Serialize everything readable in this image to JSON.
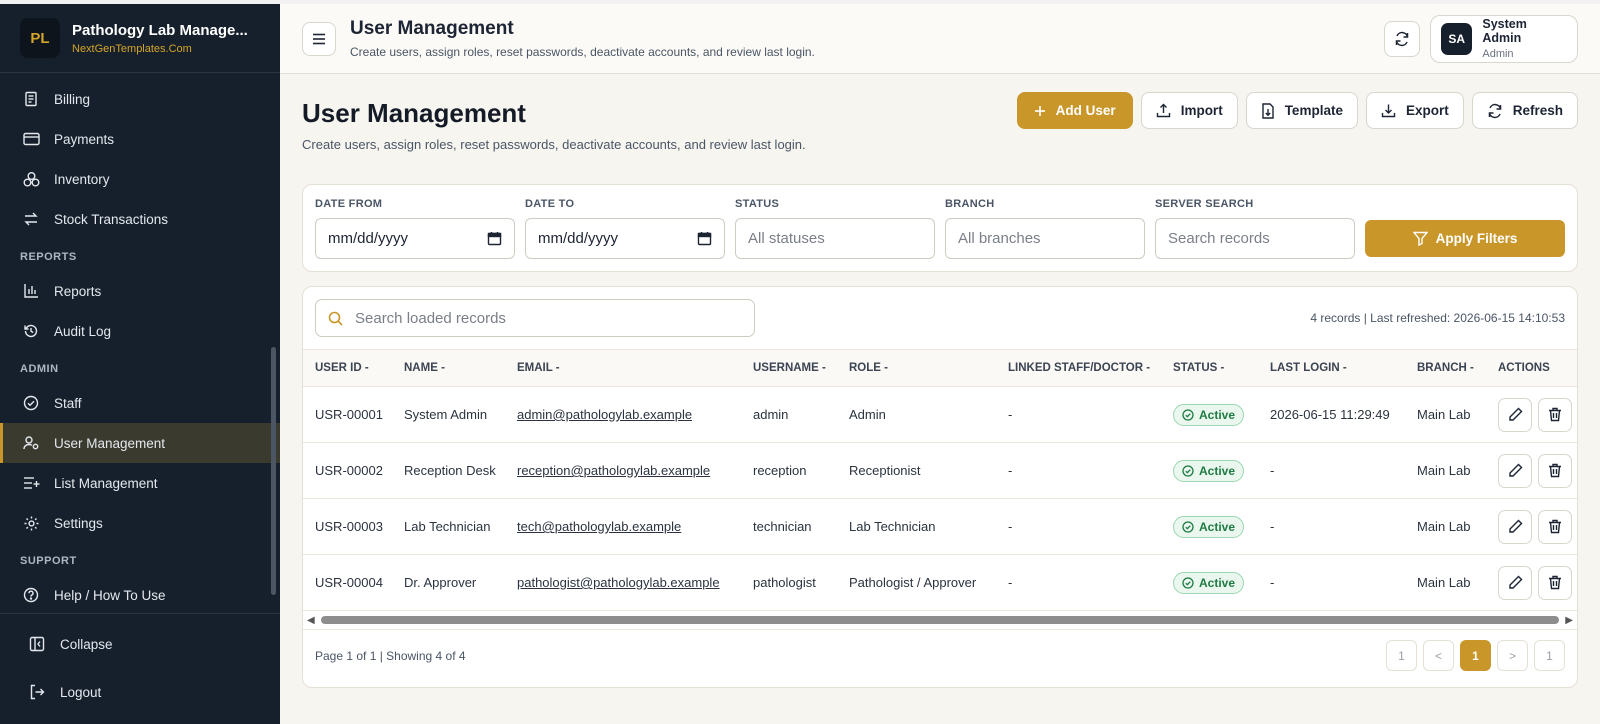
{
  "brand": {
    "logo": "PL",
    "title": "Pathology Lab Manage...",
    "subtitle": "NextGenTemplates.Com"
  },
  "sidebar": {
    "items_top": [
      {
        "label": "Billing",
        "icon": "receipt-icon"
      },
      {
        "label": "Payments",
        "icon": "credit-card-icon"
      },
      {
        "label": "Inventory",
        "icon": "boxes-icon"
      },
      {
        "label": "Stock Transactions",
        "icon": "arrows-swap-icon"
      }
    ],
    "section_reports": "REPORTS",
    "items_reports": [
      {
        "label": "Reports",
        "icon": "bar-chart-icon"
      },
      {
        "label": "Audit Log",
        "icon": "history-icon"
      }
    ],
    "section_admin": "ADMIN",
    "items_admin": [
      {
        "label": "Staff",
        "icon": "check-circle-icon"
      },
      {
        "label": "User Management",
        "icon": "user-cog-icon"
      },
      {
        "label": "List Management",
        "icon": "list-plus-icon"
      },
      {
        "label": "Settings",
        "icon": "gear-icon"
      }
    ],
    "section_support": "SUPPORT",
    "items_support": [
      {
        "label": "Help / How To Use",
        "icon": "help-circle-icon"
      }
    ],
    "collapse": "Collapse",
    "logout": "Logout"
  },
  "topbar": {
    "title": "User Management",
    "subtitle": "Create users, assign roles, reset passwords, deactivate accounts, and review last login.",
    "user": {
      "initials": "SA",
      "name": "System Admin",
      "role": "Admin"
    }
  },
  "page": {
    "title": "User Management",
    "subtitle": "Create users, assign roles, reset passwords, deactivate accounts, and review last login.",
    "buttons": {
      "add": "Add User",
      "import": "Import",
      "template": "Template",
      "export": "Export",
      "refresh": "Refresh"
    }
  },
  "filters": {
    "date_from_label": "DATE FROM",
    "date_from_value": "mm/dd/yyyy",
    "date_to_label": "DATE TO",
    "date_to_value": "mm/dd/yyyy",
    "status_label": "STATUS",
    "status_placeholder": "All statuses",
    "branch_label": "BRANCH",
    "branch_placeholder": "All branches",
    "search_label": "SERVER SEARCH",
    "search_placeholder": "Search records",
    "apply": "Apply Filters"
  },
  "table": {
    "search_placeholder": "Search loaded records",
    "meta": "4 records | Last refreshed: 2026-06-15 14:10:53",
    "columns": [
      "USER ID",
      "NAME",
      "EMAIL",
      "USERNAME",
      "ROLE",
      "LINKED STAFF/DOCTOR",
      "STATUS",
      "LAST LOGIN",
      "BRANCH",
      "ACTIONS"
    ],
    "sort_marker": "-",
    "rows": [
      {
        "id": "USR-00001",
        "name": "System Admin",
        "email": "admin@pathologylab.example",
        "username": "admin",
        "role": "Admin",
        "linked": "-",
        "status": "Active",
        "last_login": "2026-06-15 11:29:49",
        "branch": "Main Lab"
      },
      {
        "id": "USR-00002",
        "name": "Reception Desk",
        "email": "reception@pathologylab.example",
        "username": "reception",
        "role": "Receptionist",
        "linked": "-",
        "status": "Active",
        "last_login": "-",
        "branch": "Main Lab"
      },
      {
        "id": "USR-00003",
        "name": "Lab Technician",
        "email": "tech@pathologylab.example",
        "username": "technician",
        "role": "Lab Technician",
        "linked": "-",
        "status": "Active",
        "last_login": "-",
        "branch": "Main Lab"
      },
      {
        "id": "USR-00004",
        "name": "Dr. Approver",
        "email": "pathologist@pathologylab.example",
        "username": "pathologist",
        "role": "Pathologist / Approver",
        "linked": "-",
        "status": "Active",
        "last_login": "-",
        "branch": "Main Lab"
      }
    ],
    "footer": "Page 1 of 1 | Showing 4 of 4",
    "pager": {
      "first": "1",
      "prev": "<",
      "current": "1",
      "next": ">",
      "last": "1"
    }
  },
  "colors": {
    "accent": "#c9962a",
    "sidebar": "#16202c",
    "active_badge": "#1f7a44"
  }
}
